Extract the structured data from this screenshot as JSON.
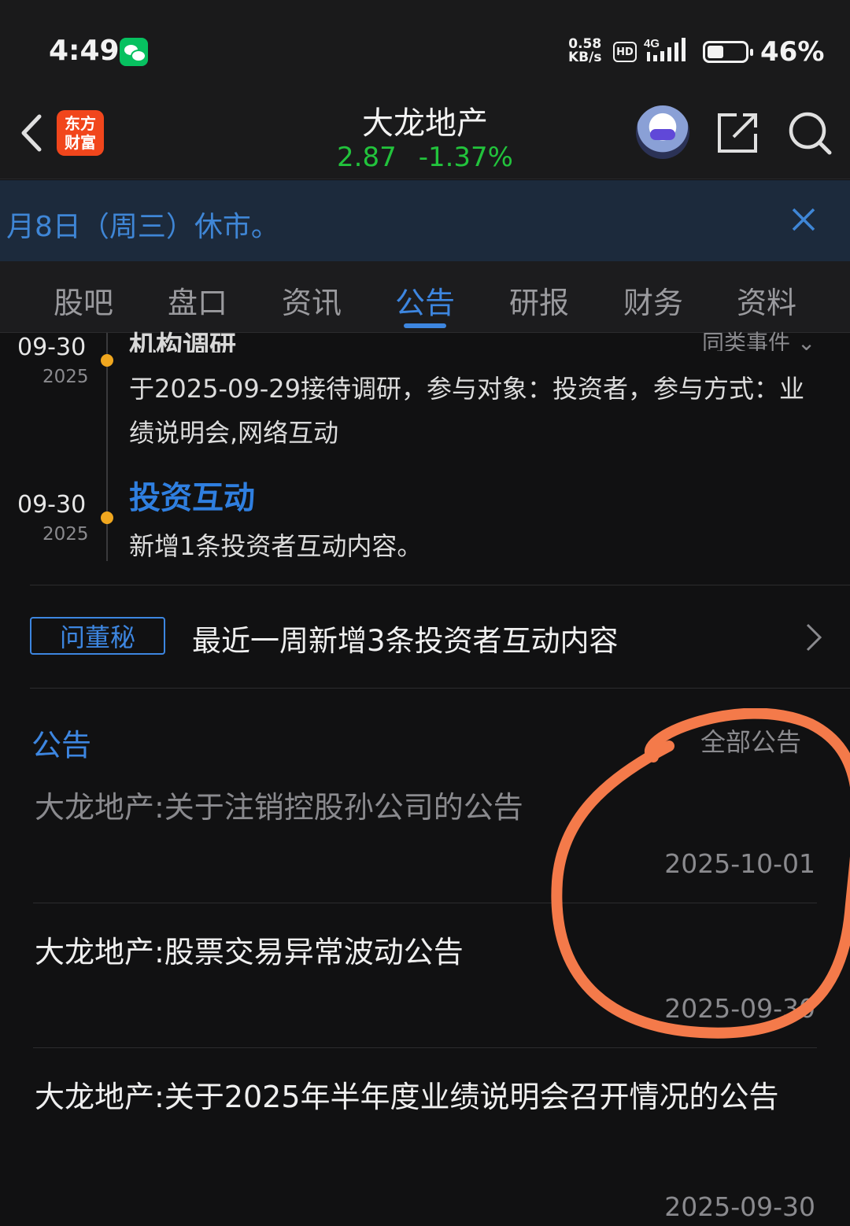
{
  "status_bar": {
    "time": "4:49",
    "net_speed_value": "0.58",
    "net_speed_unit": "KB/s",
    "hd_label": "HD",
    "network_type": "4G",
    "battery": "46%"
  },
  "header": {
    "app_logo_line1": "东方",
    "app_logo_line2": "财富",
    "stock_name": "大龙地产",
    "price": "2.87",
    "change": "-1.37%"
  },
  "notice": {
    "text": "月8日（周三）休市。"
  },
  "tabs": [
    {
      "label": "股吧"
    },
    {
      "label": "盘口"
    },
    {
      "label": "资讯"
    },
    {
      "label": "公告"
    },
    {
      "label": "研报"
    },
    {
      "label": "财务"
    },
    {
      "label": "资料"
    }
  ],
  "timeline": {
    "filter_label": "同类事件",
    "items": [
      {
        "date": "09-30",
        "year": "2025",
        "title": "机构调研",
        "body": "于2025-09-29接待调研，参与对象：投资者，参与方式：业绩说明会,网络互动"
      },
      {
        "date": "09-30",
        "year": "2025",
        "title": "投资互动",
        "body": "新增1条投资者互动内容。"
      }
    ]
  },
  "secretary": {
    "tag": "问董秘",
    "text": "最近一周新增3条投资者互动内容"
  },
  "announcements": {
    "heading": "公告",
    "filter_label": "全部公告",
    "items": [
      {
        "title": "大龙地产:关于注销控股孙公司的公告",
        "date": "2025-10-01",
        "read": true
      },
      {
        "title": "大龙地产:股票交易异常波动公告",
        "date": "2025-09-30",
        "read": false
      },
      {
        "title": "大龙地产:关于2025年半年度业绩说明会召开情况的公告",
        "date": "2025-09-30",
        "read": false
      }
    ]
  },
  "colors": {
    "accent": "#3d86e0",
    "price_green": "#22c33c",
    "timeline_dot": "#f0a71f",
    "annotation": "#f47a4a"
  }
}
